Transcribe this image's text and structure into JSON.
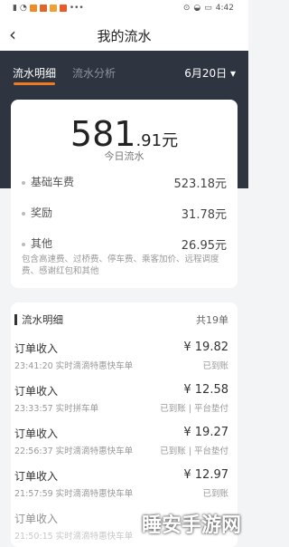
{
  "status_bar": {
    "time": "4:42",
    "icons_left": [
      "sim-icon",
      "wifi-icon",
      "app-icon-1",
      "app-icon-2",
      "app-icon-3",
      "app-icon-4",
      "more-dots-icon"
    ],
    "icons_right": [
      "location-icon",
      "wifi-icon",
      "battery-icon"
    ]
  },
  "header": {
    "title": "我的流水"
  },
  "tabs": [
    {
      "label": "流水明细",
      "active": true
    },
    {
      "label": "流水分析",
      "active": false
    }
  ],
  "date_selector": {
    "label": "6月20日 ▾"
  },
  "summary": {
    "amount_int": "581",
    "amount_dec": ".91元",
    "caption": "今日流水",
    "rows": [
      {
        "label": "基础车费",
        "value": "523.18元"
      },
      {
        "label": "奖励",
        "value": "31.78元"
      },
      {
        "label": "其他",
        "value": "26.95元"
      }
    ],
    "note": "包含高速费、过桥费、停车费、乘客加价、远程调度费、感谢红包和其他"
  },
  "list": {
    "title": "流水明细",
    "count": "共19单",
    "items": [
      {
        "type": "订单收入",
        "amount": "¥ 19.82",
        "time": "23:41:20 实时滴滴特惠快车单",
        "status": "已到账"
      },
      {
        "type": "订单收入",
        "amount": "¥ 12.58",
        "time": "23:33:57 实时拼车单",
        "status": "已到账 | 平台垫付"
      },
      {
        "type": "订单收入",
        "amount": "¥ 19.27",
        "time": "22:56:37 实时滴滴特惠快车单",
        "status": "已到账 | 平台垫付"
      },
      {
        "type": "订单收入",
        "amount": "¥ 12.97",
        "time": "21:57:59 实时滴滴特惠快车单",
        "status": "已到账"
      },
      {
        "type": "订单收入",
        "amount": "",
        "time": "21:50:15 实时滴滴特惠快车单",
        "status": ""
      }
    ]
  },
  "watermark": "睡安手游网",
  "colors": {
    "accent": "#f07a20",
    "dark_bg": "#2e3541"
  }
}
